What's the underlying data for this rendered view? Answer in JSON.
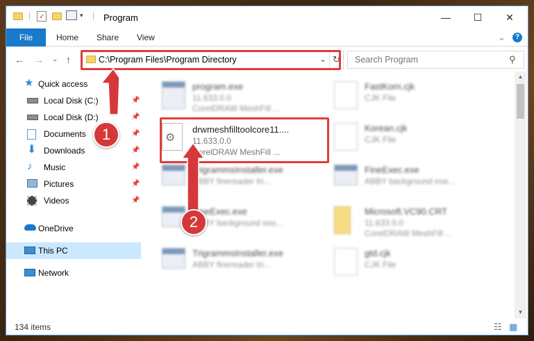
{
  "window": {
    "title": "Program",
    "minimize_glyph": "—",
    "maximize_glyph": "☐",
    "close_glyph": "✕"
  },
  "ribbon": {
    "tabs": [
      "File",
      "Home",
      "Share",
      "View"
    ],
    "expand_glyph": "⌄",
    "help_glyph": "?"
  },
  "nav": {
    "back_glyph": "←",
    "forward_glyph": "→",
    "recent_glyph": "⌄",
    "up_glyph": "↑",
    "address": "C:\\Program Files\\Program Directory",
    "address_dropdown_glyph": "⌄",
    "refresh_glyph": "↻",
    "search_placeholder": "Search Program",
    "search_icon_glyph": "⚲"
  },
  "sidebar": {
    "items": [
      {
        "label": "Quick access",
        "icon": "star-icon",
        "pinned": false
      },
      {
        "label": "Local Disk (C:)",
        "icon": "drive-icon",
        "pinned": true
      },
      {
        "label": "Local Disk (D:)",
        "icon": "drive-icon",
        "pinned": true
      },
      {
        "label": "Documents",
        "icon": "documents-icon",
        "pinned": true
      },
      {
        "label": "Downloads",
        "icon": "download-icon",
        "pinned": true
      },
      {
        "label": "Music",
        "icon": "music-icon",
        "pinned": true
      },
      {
        "label": "Pictures",
        "icon": "pictures-icon",
        "pinned": true
      },
      {
        "label": "Videos",
        "icon": "videos-icon",
        "pinned": true
      },
      {
        "label": "OneDrive",
        "icon": "cloud-icon",
        "pinned": false
      },
      {
        "label": "This PC",
        "icon": "computer-icon",
        "pinned": false
      },
      {
        "label": "Network",
        "icon": "network-icon",
        "pinned": false
      }
    ],
    "pin_glyph": "📌"
  },
  "files": [
    {
      "name": "program.exe",
      "version": "11.633.0.0",
      "desc": "CorelDRAW MeshFill ...",
      "type": "exe"
    },
    {
      "name": "FastKorn.cjk",
      "version": "CJK File",
      "desc": "",
      "type": "doc"
    },
    {
      "name": "drwmeshfilltoolcore11....",
      "version": "11.633.0.0",
      "desc": "CorelDRAW MeshFill ...",
      "type": "dll"
    },
    {
      "name": "Korean.cjk",
      "version": "CJK File",
      "desc": "",
      "type": "doc"
    },
    {
      "name": "TrigrammsInstaller.exe",
      "version": "ABBY finereader tri...",
      "desc": "",
      "type": "exe"
    },
    {
      "name": "FineExec.exe",
      "version": "ABBY background exe...",
      "desc": "",
      "type": "exe"
    },
    {
      "name": "FineExec.exe",
      "version": "ABBY background exe...",
      "desc": "",
      "type": "exe"
    },
    {
      "name": "Microsoft.VC90.CRT",
      "version": "11.633.0.0",
      "desc": "CorelDRAW MeshFill ...",
      "type": "folder"
    },
    {
      "name": "TrigrammsInstaller.exe",
      "version": "ABBY finereader tri...",
      "desc": "",
      "type": "exe"
    },
    {
      "name": "gtd.cjk",
      "version": "CJK File",
      "desc": "",
      "type": "doc"
    }
  ],
  "status": {
    "count": "134 items",
    "details_view_glyph": "☷",
    "tiles_view_glyph": "▦"
  },
  "annotations": {
    "step1": "1",
    "step2": "2",
    "color": "#d6383a"
  },
  "colors": {
    "accent": "#1979ca",
    "selection": "#cce8ff",
    "highlight": "#e23b3b"
  }
}
